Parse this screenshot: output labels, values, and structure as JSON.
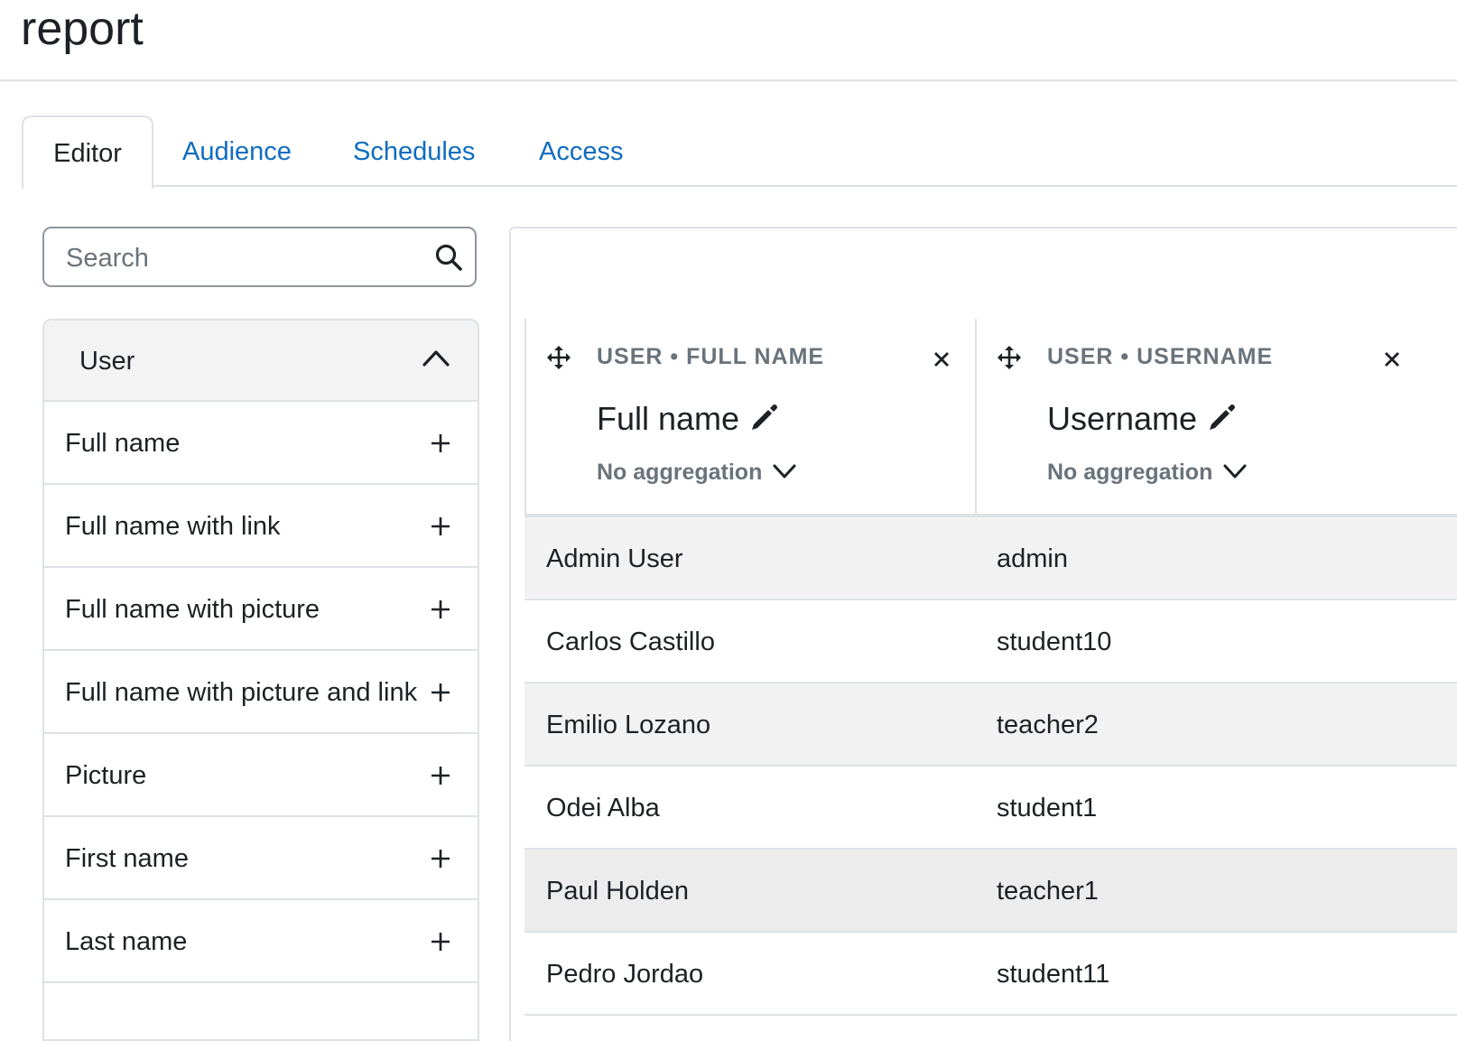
{
  "page": {
    "title": "report"
  },
  "tabs": [
    {
      "label": "Editor",
      "active": true
    },
    {
      "label": "Audience"
    },
    {
      "label": "Schedules"
    },
    {
      "label": "Access"
    }
  ],
  "search": {
    "placeholder": "Search"
  },
  "sidebar": {
    "group": "User",
    "items": [
      {
        "label": "Full name"
      },
      {
        "label": "Full name with link"
      },
      {
        "label": "Full name with picture"
      },
      {
        "label": "Full name with picture and link"
      },
      {
        "label": "Picture"
      },
      {
        "label": "First name"
      },
      {
        "label": "Last name"
      }
    ]
  },
  "columns": [
    {
      "type": "USER • FULL NAME",
      "title": "Full name",
      "aggregation": "No aggregation"
    },
    {
      "type": "USER • USERNAME",
      "title": "Username",
      "aggregation": "No aggregation"
    }
  ],
  "rows": [
    {
      "name": "Admin User",
      "username": "admin"
    },
    {
      "name": "Carlos Castillo",
      "username": "student10"
    },
    {
      "name": "Emilio Lozano",
      "username": "teacher2"
    },
    {
      "name": "Odei Alba",
      "username": "student1"
    },
    {
      "name": "Paul Holden",
      "username": "teacher1"
    },
    {
      "name": "Pedro Jordao",
      "username": "student11"
    }
  ],
  "colors": {
    "link": "#0f6cbf",
    "text": "#1d2125",
    "muted": "#6a737b",
    "border": "#dee2e6"
  }
}
